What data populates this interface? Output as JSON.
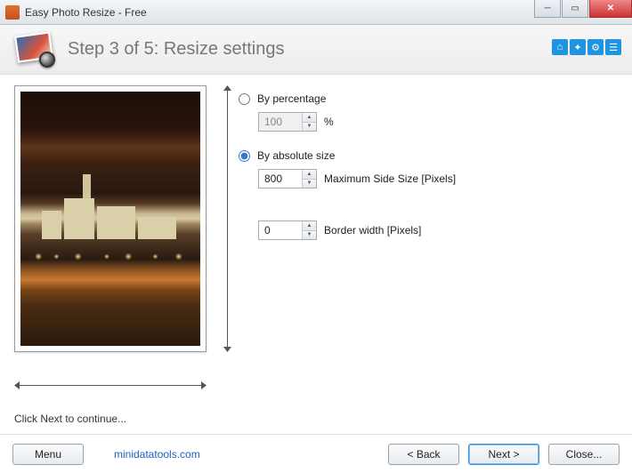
{
  "window": {
    "title": "Easy Photo Resize - Free"
  },
  "header": {
    "step_title": "Step 3 of 5: Resize settings",
    "toolbar": {
      "home": "⌂",
      "settings": "✦",
      "gear": "⚙",
      "list": "☰"
    }
  },
  "settings": {
    "by_percentage": {
      "label": "By percentage",
      "value": "100",
      "suffix": "%",
      "checked": false
    },
    "by_absolute": {
      "label": "By absolute size",
      "value": "800",
      "field_label": "Maximum Side Size [Pixels]",
      "checked": true
    },
    "border": {
      "value": "0",
      "field_label": "Border width [Pixels]"
    }
  },
  "hint": "Click Next to continue...",
  "footer": {
    "menu": "Menu",
    "link_text": "minidatatools.com",
    "back": "< Back",
    "next": "Next >",
    "close": "Close..."
  }
}
